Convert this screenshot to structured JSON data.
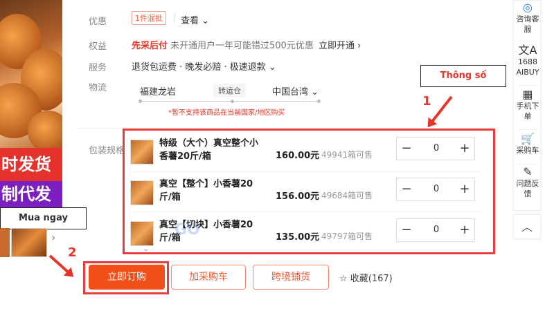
{
  "left_banner": {
    "promo_line1": "时发货",
    "promo_line2": "制代发"
  },
  "rows": {
    "discount": {
      "label": "优惠",
      "tag": "1件混批",
      "link": "查看 ⌄"
    },
    "rights": {
      "label": "权益",
      "highlight": "先采后付",
      "note": "未开通用户一年可能错过500元优惠",
      "link": "立即开通 ›"
    },
    "service": {
      "label": "服务",
      "text": "退货包运费 · 晚发必赔 · 极速退款 ⌄"
    },
    "logistics": {
      "label": "物流",
      "from": "福建龙岩",
      "via": "转运仓",
      "to": "中国台湾 ⌄",
      "warning": "*暂不支持该商品在当前国家/地区购买"
    }
  },
  "spec_label": "包装规格",
  "variants": [
    {
      "name": "特级（大个）真空整个小香薯20斤/箱",
      "price": "160.00元",
      "stock": "49941箱可售",
      "qty": "0"
    },
    {
      "name": "真空【整个】小香薯20斤/箱",
      "price": "156.00元",
      "stock": "49684箱可售",
      "qty": "0"
    },
    {
      "name": "真空【切块】小香薯20斤/箱",
      "price": "135.00元",
      "stock": "49797箱可售",
      "qty": "0"
    }
  ],
  "actions": {
    "buy_now": "立即订购",
    "add_cart": "加采购车",
    "cross_border": "跨境铺货",
    "favorite": "收藏(167)"
  },
  "annotations": {
    "spec_label": "Thông số",
    "buy_label": "Mua ngay",
    "num1": "1",
    "num2": "2",
    "watermark": "GO"
  },
  "sidebar": [
    {
      "icon": "consult-icon",
      "label": "咨询客服"
    },
    {
      "icon": "translate-icon",
      "label": "1688 AIBUY"
    },
    {
      "icon": "qr-icon",
      "label": "手机下单"
    },
    {
      "icon": "cart-icon",
      "label": "采购车"
    },
    {
      "icon": "edit-icon",
      "label": "问题反馈"
    }
  ],
  "colors": {
    "accent": "#f1501a",
    "annotation_red": "#e8352a",
    "tag_red": "#f05a38"
  }
}
